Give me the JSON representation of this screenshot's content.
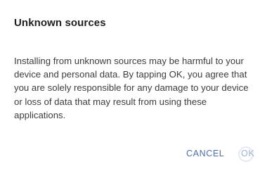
{
  "dialog": {
    "title": "Unknown sources",
    "message": "Installing from unknown sources may be harmful to your device and personal data. By tapping OK, you agree that you are solely responsible for any damage to your device or loss of data that may result from using these applications.",
    "cancel_label": "CANCEL",
    "ok_label": "OK"
  },
  "colors": {
    "accent": "#4f6fa8",
    "title_text": "#1f1f1f",
    "body_text": "#3c3c3c",
    "background": "#ffffff"
  }
}
